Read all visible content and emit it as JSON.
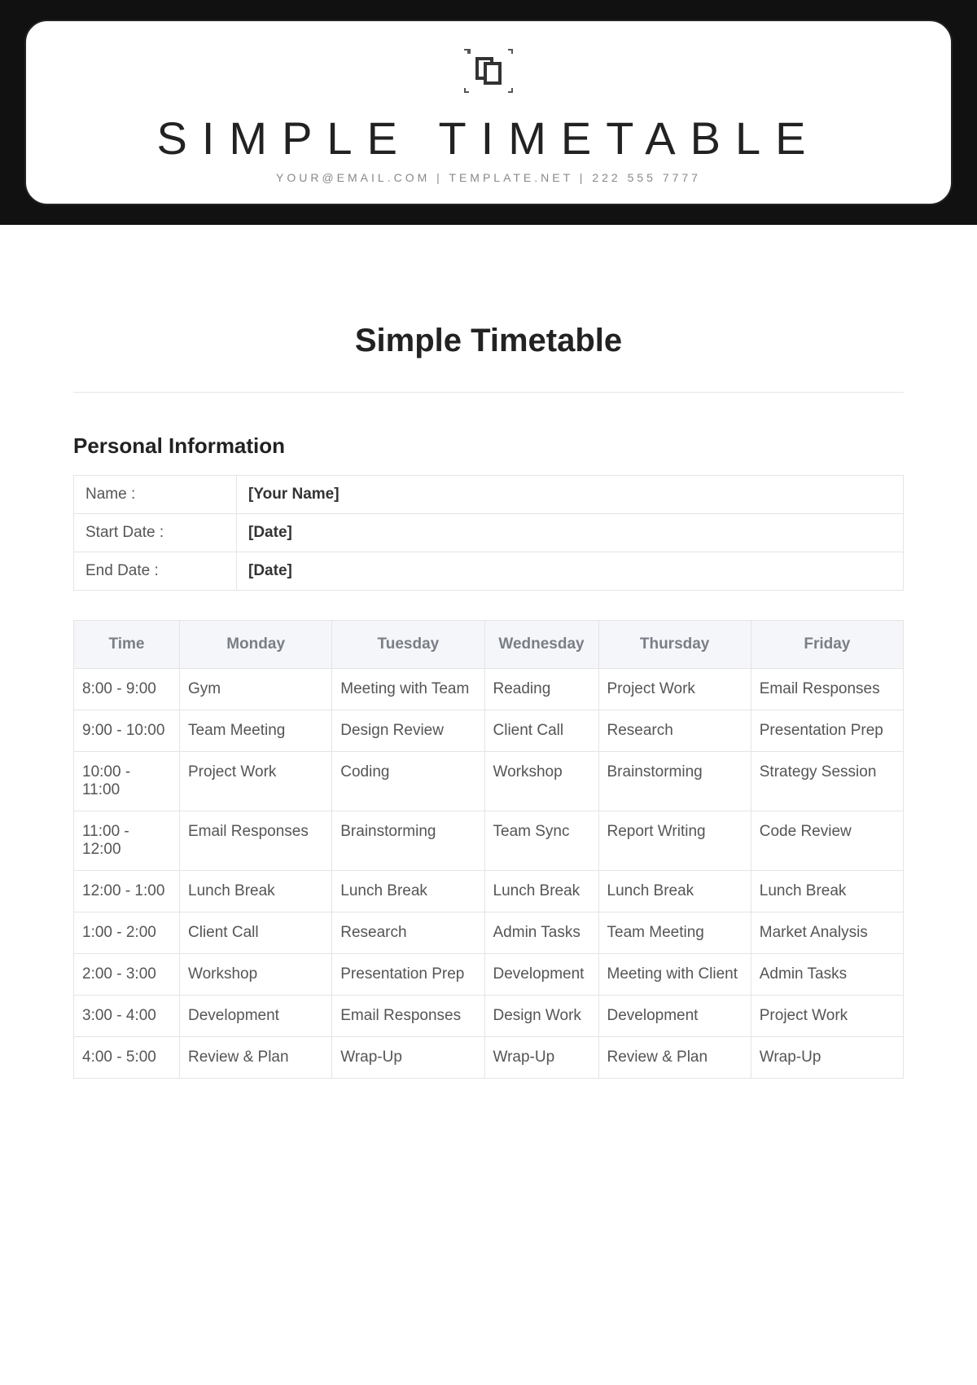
{
  "header": {
    "brand_title": "SIMPLE TIMETABLE",
    "brand_sub": "YOUR@EMAIL.COM | TEMPLATE.NET | 222 555 7777"
  },
  "document": {
    "title": "Simple Timetable",
    "section_title": "Personal Information"
  },
  "info": {
    "rows": [
      {
        "label": "Name :",
        "value": "[Your Name]"
      },
      {
        "label": "Start Date :",
        "value": "[Date]"
      },
      {
        "label": "End Date :",
        "value": "[Date]"
      }
    ]
  },
  "schedule": {
    "headers": [
      "Time",
      "Monday",
      "Tuesday",
      "Wednesday",
      "Thursday",
      "Friday"
    ],
    "rows": [
      {
        "time": "8:00 - 9:00",
        "mon": "Gym",
        "tue": "Meeting with Team",
        "wed": "Reading",
        "thu": "Project Work",
        "fri": "Email Responses"
      },
      {
        "time": "9:00 - 10:00",
        "mon": "Team Meeting",
        "tue": "Design Review",
        "wed": "Client Call",
        "thu": "Research",
        "fri": "Presentation Prep"
      },
      {
        "time": "10:00 - 11:00",
        "mon": "Project Work",
        "tue": "Coding",
        "wed": "Workshop",
        "thu": "Brainstorming",
        "fri": "Strategy Session"
      },
      {
        "time": "11:00 - 12:00",
        "mon": "Email Responses",
        "tue": "Brainstorming",
        "wed": "Team Sync",
        "thu": "Report Writing",
        "fri": "Code Review"
      },
      {
        "time": "12:00 - 1:00",
        "mon": "Lunch Break",
        "tue": "Lunch Break",
        "wed": "Lunch Break",
        "thu": "Lunch Break",
        "fri": "Lunch Break"
      },
      {
        "time": "1:00 - 2:00",
        "mon": "Client Call",
        "tue": "Research",
        "wed": "Admin Tasks",
        "thu": "Team Meeting",
        "fri": "Market Analysis"
      },
      {
        "time": "2:00 - 3:00",
        "mon": "Workshop",
        "tue": "Presentation Prep",
        "wed": "Development",
        "thu": "Meeting with Client",
        "fri": "Admin Tasks"
      },
      {
        "time": "3:00 - 4:00",
        "mon": "Development",
        "tue": "Email Responses",
        "wed": "Design Work",
        "thu": "Development",
        "fri": "Project Work"
      },
      {
        "time": "4:00 - 5:00",
        "mon": "Review & Plan",
        "tue": "Wrap-Up",
        "wed": "Wrap-Up",
        "thu": "Review & Plan",
        "fri": "Wrap-Up"
      }
    ]
  }
}
